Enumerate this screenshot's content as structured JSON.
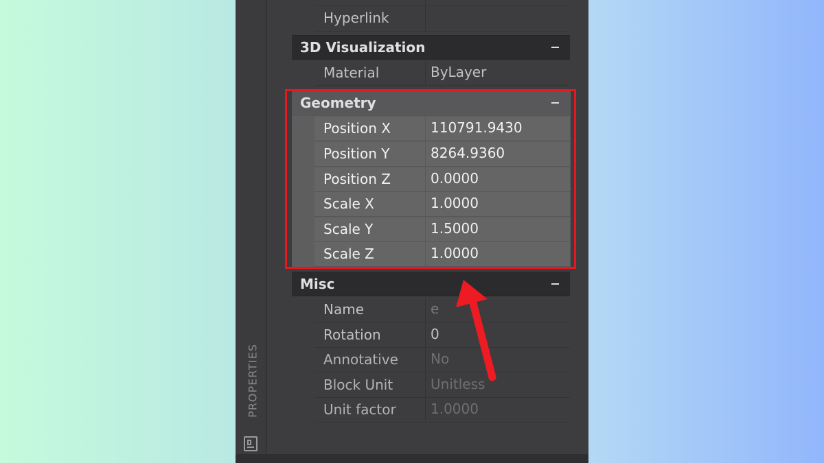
{
  "panel": {
    "side_label": "PROPERTIES",
    "side_icon": "properties-panel-icon"
  },
  "top_rows": [
    {
      "label": "",
      "value": ""
    },
    {
      "label": "Hyperlink",
      "value": ""
    }
  ],
  "sections": {
    "visualization": {
      "title": "3D Visualization",
      "rows": [
        {
          "label": "Material",
          "value": "ByLayer"
        }
      ]
    },
    "geometry": {
      "title": "Geometry",
      "rows": [
        {
          "label": "Position X",
          "value": "110791.9430"
        },
        {
          "label": "Position Y",
          "value": "8264.9360"
        },
        {
          "label": "Position Z",
          "value": "0.0000"
        },
        {
          "label": "Scale X",
          "value": "1.0000"
        },
        {
          "label": "Scale Y",
          "value": "1.5000"
        },
        {
          "label": "Scale Z",
          "value": "1.0000"
        }
      ]
    },
    "misc": {
      "title": "Misc",
      "rows": [
        {
          "label": "Name",
          "value": "e"
        },
        {
          "label": "Rotation",
          "value": "0"
        },
        {
          "label": "Annotative",
          "value": "No"
        },
        {
          "label": "Block Unit",
          "value": "Unitless"
        },
        {
          "label": "Unit factor",
          "value": "1.0000"
        }
      ]
    }
  },
  "colors": {
    "highlight": "#e8171f",
    "arrow": "#ee1b23",
    "panel_bg": "#3b3b3d"
  }
}
